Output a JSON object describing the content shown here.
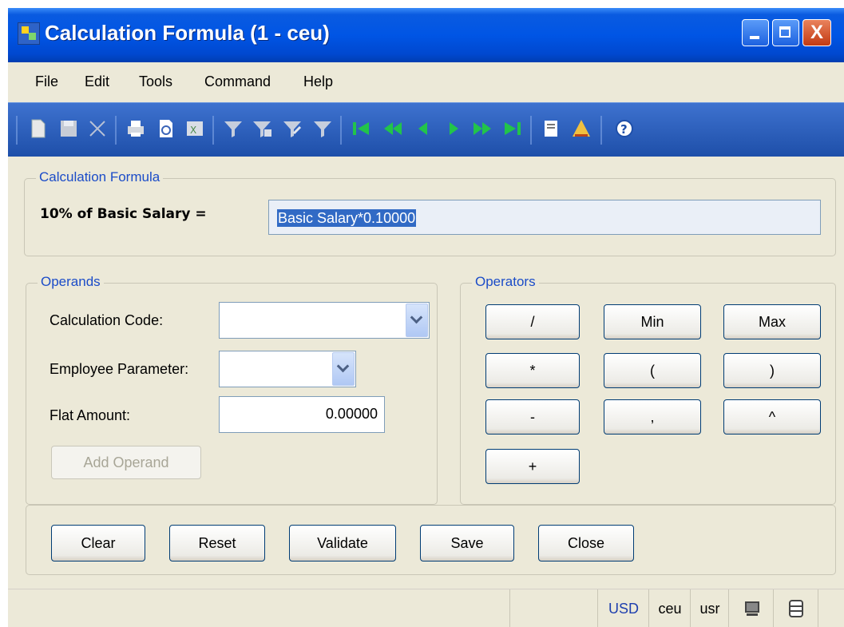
{
  "window": {
    "title": "Calculation Formula (1 - ceu)",
    "close_glyph": "X"
  },
  "menu": [
    "File",
    "Edit",
    "Tools",
    "Command",
    "Help"
  ],
  "formula_group": {
    "legend": "Calculation Formula",
    "label": "10% of Basic Salary =",
    "value": "Basic Salary*0.10000"
  },
  "operands": {
    "legend": "Operands",
    "calc_code_label": "Calculation Code:",
    "calc_code_value": "",
    "emp_param_label": "Employee Parameter:",
    "emp_param_value": "",
    "flat_amount_label": "Flat Amount:",
    "flat_amount_value": "0.00000",
    "add_operand": "Add Operand"
  },
  "operators": {
    "legend": "Operators",
    "buttons": [
      "/",
      "Min",
      "Max",
      "*",
      "(",
      ")",
      "-",
      ",",
      "^",
      "+"
    ]
  },
  "actions": {
    "clear": "Clear",
    "reset": "Reset",
    "validate": "Validate",
    "save": "Save",
    "close": "Close"
  },
  "status": {
    "currency": "USD",
    "company": "ceu",
    "user": "usr"
  },
  "colors": {
    "title_bar": "#0055E5",
    "toolbar": "#2A5CBA",
    "legend_text": "#1B4CC8",
    "selection": "#316AC5",
    "nav_arrows": "#22C44A"
  },
  "toolbar_icons": [
    "new-icon",
    "save-icon",
    "delete-icon",
    "print-icon",
    "print-preview-icon",
    "export-excel-icon",
    "filter-icon",
    "filter-add-icon",
    "filter-edit-icon",
    "filter-remove-icon",
    "first-record-icon",
    "previous-page-icon",
    "previous-record-icon",
    "next-record-icon",
    "next-page-icon",
    "last-record-icon",
    "notes-icon",
    "alert-icon",
    "help-icon"
  ]
}
